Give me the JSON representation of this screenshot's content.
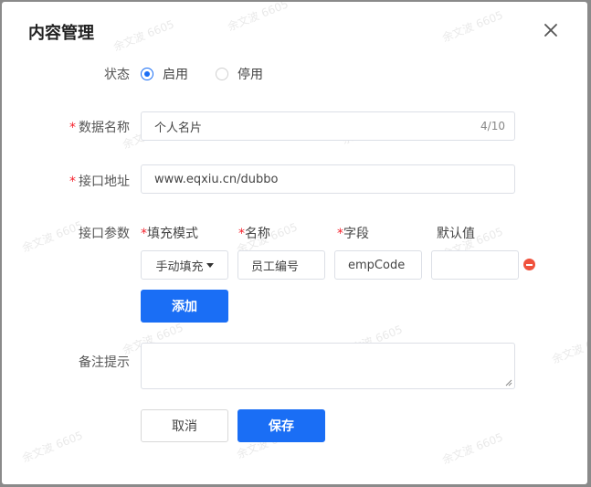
{
  "dialog": {
    "title": "内容管理"
  },
  "watermark": {
    "text": "余文波 6605"
  },
  "status": {
    "label": "状态",
    "options": [
      {
        "label": "启用",
        "checked": true
      },
      {
        "label": "停用",
        "checked": false
      }
    ]
  },
  "data_name": {
    "label": "数据名称",
    "required": "*",
    "value": "个人名片",
    "counter": "4/10"
  },
  "api_url": {
    "label": "接口地址",
    "required": "*",
    "value": "www.eqxiu.cn/dubbo"
  },
  "api_params": {
    "label": "接口参数",
    "columns": [
      {
        "required": "*",
        "label": "填充模式"
      },
      {
        "required": "*",
        "label": "名称"
      },
      {
        "required": "*",
        "label": "字段"
      },
      {
        "required": "",
        "label": "默认值"
      }
    ],
    "row": {
      "fill_mode": "手动填充",
      "name": "员工编号",
      "field": "empCode",
      "default": ""
    },
    "add_label": "添加"
  },
  "remark": {
    "label": "备注提示",
    "value": ""
  },
  "footer": {
    "cancel_label": "取消",
    "save_label": "保存"
  },
  "colors": {
    "primary": "#1a6ef5",
    "danger": "#f0523d",
    "required": "#f5222d"
  }
}
